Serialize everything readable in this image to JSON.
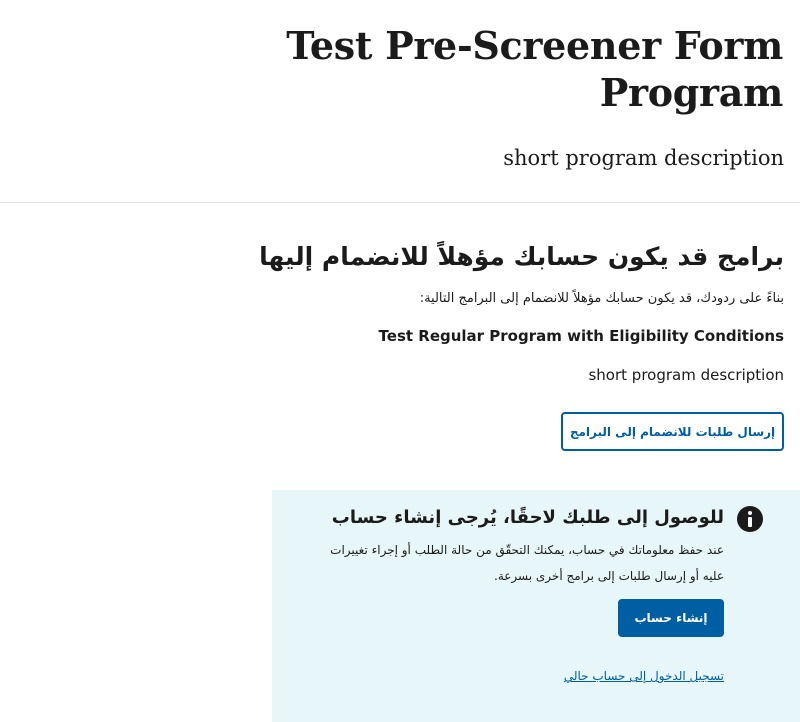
{
  "header": {
    "program_title": "Test Pre-Screener Form Program",
    "program_description": "short program description"
  },
  "results": {
    "heading": "برامج قد يكون حسابك مؤهلاً للانضمام إليها",
    "intro": "بناءً على ردودك، قد يكون حسابك مؤهلاً للانضمام إلى البرامج التالية:",
    "programs": [
      {
        "name": "Test Regular Program with Eligibility Conditions",
        "description": "short program description"
      }
    ],
    "apply_button_label": "إرسال طلبات للانضمام إلى البرامج"
  },
  "alert": {
    "icon": "info-icon",
    "heading": "للوصول إلى طلبك لاحقًا، يُرجى إنشاء حساب",
    "body": "عند حفظ معلوماتك في حساب، يمكنك التحقّق من حالة الطلب أو إجراء تغييرات عليه أو إرسال طلبات إلى برامج أخرى بسرعة.",
    "create_account_label": "إنشاء حساب",
    "sign_in_link_label": "تسجيل الدخول إلى حساب حالي"
  },
  "colors": {
    "primary": "#005ea2",
    "alert_background": "#e7f6f8",
    "text": "#1b1b1b",
    "divider": "#dfe1e2"
  }
}
